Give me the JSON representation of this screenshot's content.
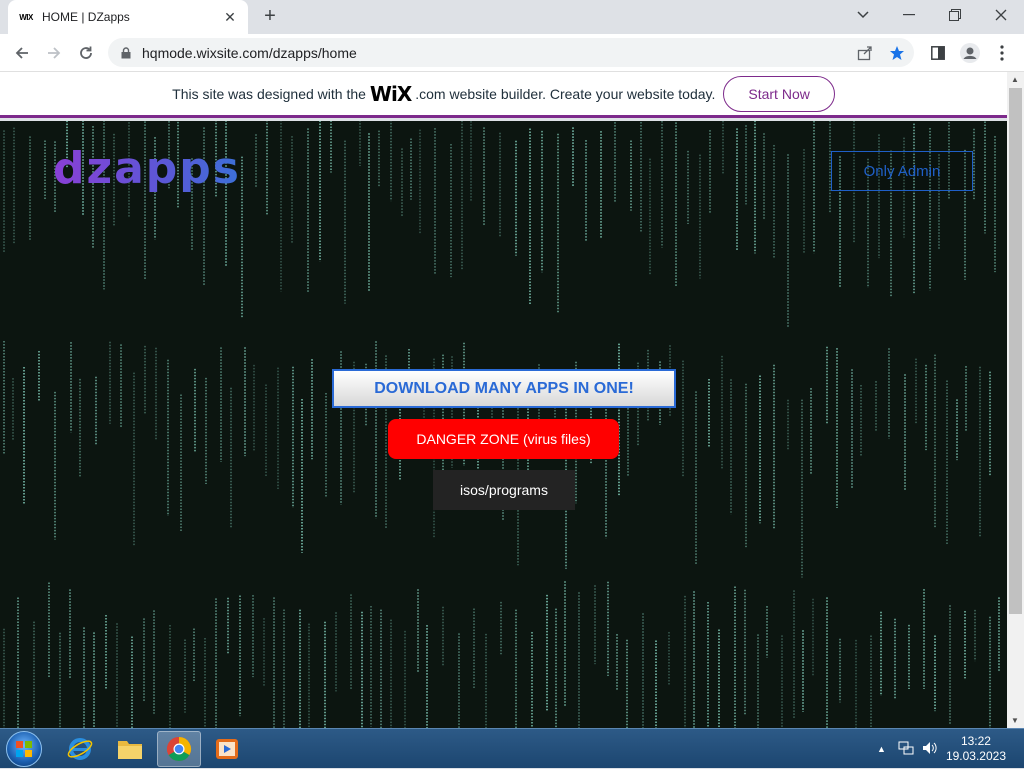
{
  "browser": {
    "tab_favicon": "WIX",
    "tab_title": "HOME | DZapps",
    "url": "hqmode.wixsite.com/dzapps/home"
  },
  "wix_banner": {
    "text_before": "This site was designed with the",
    "logo": "WiX",
    "text_after": ".com website builder. Create your website today.",
    "button": "Start Now",
    "accent_color": "#7d2a8b"
  },
  "site": {
    "logo": "dzapps",
    "admin_button": "Only Admin",
    "download_button": "DOWNLOAD MANY APPS IN ONE!",
    "danger_button": "DANGER ZONE (virus files)",
    "isos_button": "isos/programs",
    "colors": {
      "background": "#0c1510",
      "danger": "#ff0000",
      "link_blue": "#2a6ad6"
    }
  },
  "taskbar": {
    "time": "13:22",
    "date": "19.03.2023",
    "items": [
      "internet-explorer",
      "file-explorer",
      "chrome",
      "media-player"
    ]
  }
}
